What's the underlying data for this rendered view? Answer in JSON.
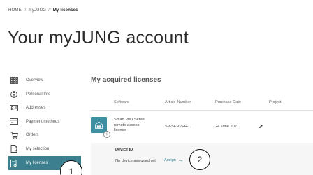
{
  "breadcrumb": {
    "home": "HOME",
    "myjung": "myJUNG",
    "current": "My licenses",
    "separator": "//"
  },
  "page": {
    "title": "Your myJUNG account"
  },
  "sidebar": {
    "items": [
      {
        "label": "Overview",
        "icon": "grid-icon"
      },
      {
        "label": "Personal Info",
        "icon": "user-icon"
      },
      {
        "label": "Addresses",
        "icon": "address-card-icon"
      },
      {
        "label": "Payment methods",
        "icon": "credit-card-icon"
      },
      {
        "label": "Orders",
        "icon": "cart-icon"
      },
      {
        "label": "My selection",
        "icon": "document-icon"
      },
      {
        "label": "My licenses",
        "icon": "license-icon",
        "active": true
      }
    ]
  },
  "licenses": {
    "section_title": "My acquired licenses",
    "columns": {
      "software": "Software",
      "article": "Article-Number",
      "date": "Purchase Date",
      "project": "Project"
    },
    "rows": [
      {
        "software": "Smart Visu Server remote access license",
        "article": "SV-SERVER-L",
        "date": "24 June 2021",
        "device_label": "Device ID",
        "device_status": "No device assigned yet",
        "assign_label": "Assign"
      }
    ]
  },
  "callouts": {
    "one": "1",
    "two": "2"
  },
  "colors": {
    "accent": "#3c7f8f",
    "thumb": "#3d8fa2",
    "link": "#2f7c8f"
  }
}
